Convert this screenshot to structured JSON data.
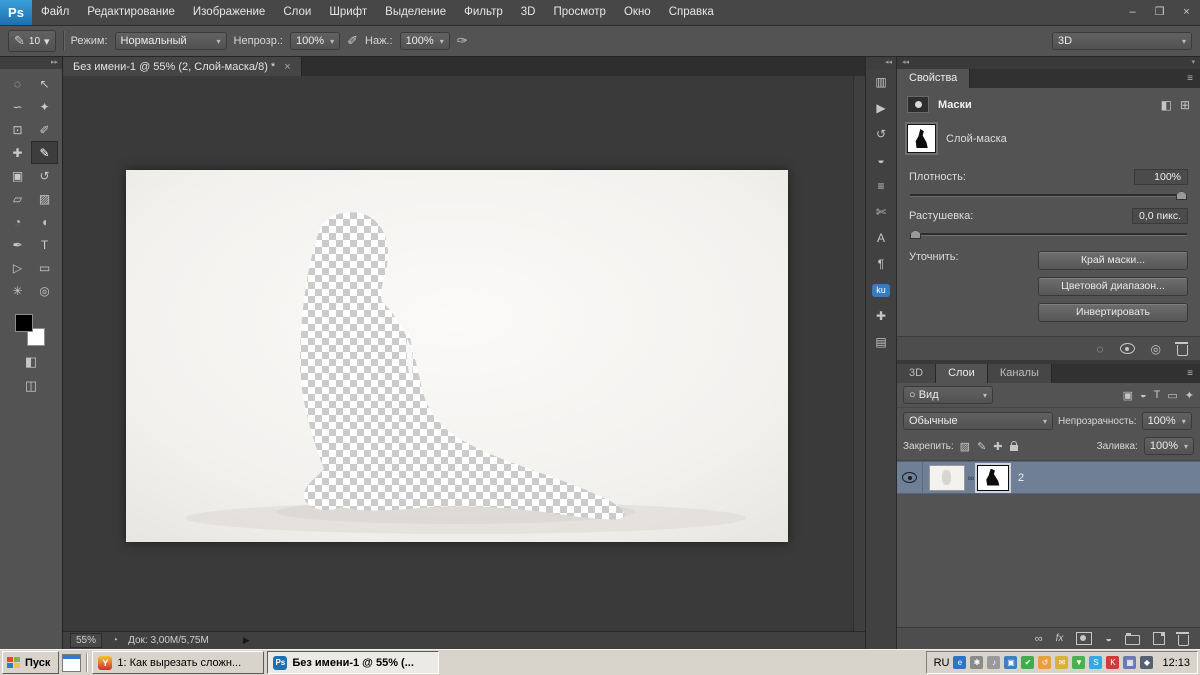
{
  "menu_bar": {
    "logo": "Ps",
    "items": [
      "Файл",
      "Редактирование",
      "Изображение",
      "Слои",
      "Шрифт",
      "Выделение",
      "Фильтр",
      "3D",
      "Просмотр",
      "Окно",
      "Справка"
    ],
    "controls": {
      "minimize": "–",
      "restore": "❐",
      "close": "×"
    }
  },
  "options_bar": {
    "brush_glyph": "✎",
    "brush_size": "10",
    "mode_label": "Режим:",
    "mode_value": "Нормальный",
    "opacity_label": "Непрозр.:",
    "opacity_value": "100%",
    "airbrush_glyph": "✐",
    "pressure_label": "Наж.:",
    "pressure_value": "100%",
    "pen_pressure_glyph": "✑",
    "workspace_value": "3D"
  },
  "toolbar": {
    "collapse_glyph": "▸▸",
    "tools": [
      {
        "name": "elliptical-marquee-tool",
        "glyph": "◌"
      },
      {
        "name": "move-tool",
        "glyph": "↖"
      },
      {
        "name": "lasso-tool",
        "glyph": "∽"
      },
      {
        "name": "quick-selection-tool",
        "glyph": "✦"
      },
      {
        "name": "crop-tool",
        "glyph": "⊡"
      },
      {
        "name": "eyedropper-tool",
        "glyph": "✐"
      },
      {
        "name": "healing-brush-tool",
        "glyph": "✚"
      },
      {
        "name": "brush-tool",
        "glyph": "✎"
      },
      {
        "name": "clone-stamp-tool",
        "glyph": "▣"
      },
      {
        "name": "history-brush-tool",
        "glyph": "↺"
      },
      {
        "name": "eraser-tool",
        "glyph": "▱"
      },
      {
        "name": "gradient-tool",
        "glyph": "▨"
      },
      {
        "name": "blur-tool",
        "glyph": "◔"
      },
      {
        "name": "dodge-tool",
        "glyph": "◖"
      },
      {
        "name": "pen-tool",
        "glyph": "✒"
      },
      {
        "name": "type-tool",
        "glyph": "T"
      },
      {
        "name": "path-selection-tool",
        "glyph": "▷"
      },
      {
        "name": "shape-tool",
        "glyph": "▭"
      },
      {
        "name": "hand-tool",
        "glyph": "✳"
      },
      {
        "name": "zoom-tool",
        "glyph": "◎"
      }
    ]
  },
  "document": {
    "tab_title": "Без имени-1 @ 55% (2, Слой-маска/8) *",
    "tab_close": "×",
    "zoom": "55%",
    "doc_sizes": "Док: 3,00M/5,75M"
  },
  "dock_strip": {
    "collapse_glyph": "◂◂",
    "icons": [
      {
        "name": "histogram-panel-icon",
        "glyph": "▥"
      },
      {
        "name": "actions-panel-icon",
        "glyph": "▶"
      },
      {
        "name": "history-panel-icon",
        "glyph": "↺"
      },
      {
        "name": "adjustments-panel-icon",
        "glyph": "◒"
      },
      {
        "name": "layer-comps-panel-icon",
        "glyph": "≡"
      },
      {
        "name": "clone-source-panel-icon",
        "glyph": "✄"
      },
      {
        "name": "character-panel-icon",
        "glyph": "A"
      },
      {
        "name": "paragraph-panel-icon",
        "glyph": "¶"
      },
      {
        "name": "kuler-panel-icon",
        "glyph": "ku"
      },
      {
        "name": "measure-panel-icon",
        "glyph": "✚"
      },
      {
        "name": "notes-panel-icon",
        "glyph": "▤"
      }
    ]
  },
  "properties": {
    "tab": "Свойства",
    "menu_glyph": "≡",
    "title": "Маски",
    "pixel_mask_glyph": "◧",
    "vector_mask_glyph": "⊞",
    "mask_label": "Слой-маска",
    "density_label": "Плотность:",
    "density_value": "100%",
    "feather_label": "Растушевка:",
    "feather_value": "0,0 пикс.",
    "refine_label": "Уточнить:",
    "mask_edge_button": "Край маски...",
    "color_range_button": "Цветовой диапазон...",
    "invert_button": "Инвертировать",
    "load_selection_glyph": "◌",
    "apply_mask_glyph": "◎"
  },
  "layers": {
    "tab_3d": "3D",
    "tab_layers": "Слои",
    "tab_channels": "Каналы",
    "menu_glyph": "≡",
    "filter_prefix_glyph": "○",
    "filter_value": "Вид",
    "filter_icons": [
      "▣",
      "◒",
      "T",
      "▭",
      "✦"
    ],
    "blend_value": "Обычные",
    "opacity_label": "Непрозрачность:",
    "opacity_value": "100%",
    "lock_label": "Закрепить:",
    "lock_transparency_glyph": "▨",
    "lock_pixels_glyph": "✎",
    "lock_position_glyph": "✚",
    "fill_label": "Заливка:",
    "fill_value": "100%",
    "layer_name": "2",
    "link_glyph": "∞",
    "fx_label": "fx",
    "adjustment_glyph": "◒"
  },
  "taskbar": {
    "start_label": "Пуск",
    "task1_label": "1: Как вырезать сложн...",
    "task1_icon": "Y",
    "task2_label": "Без имени-1 @ 55% (...",
    "task2_icon": "Ps",
    "language": "RU",
    "time": "12:13",
    "tray_icons": [
      {
        "name": "browser-tray-icon",
        "glyph": "e"
      },
      {
        "name": "settings-tray-icon",
        "glyph": "✱"
      },
      {
        "name": "volume-tray-icon",
        "glyph": "♪"
      },
      {
        "name": "network-tray-icon",
        "glyph": "▣"
      },
      {
        "name": "security-tray-icon",
        "glyph": "✔"
      },
      {
        "name": "update-tray-icon",
        "glyph": "↺"
      },
      {
        "name": "mail-tray-icon",
        "glyph": "✉"
      },
      {
        "name": "download-tray-icon",
        "glyph": "▼"
      },
      {
        "name": "skype-tray-icon",
        "glyph": "S"
      },
      {
        "name": "antivirus-tray-icon",
        "glyph": "K"
      },
      {
        "name": "display-tray-icon",
        "glyph": "▦"
      },
      {
        "name": "usb-tray-icon",
        "glyph": "◆"
      }
    ]
  }
}
